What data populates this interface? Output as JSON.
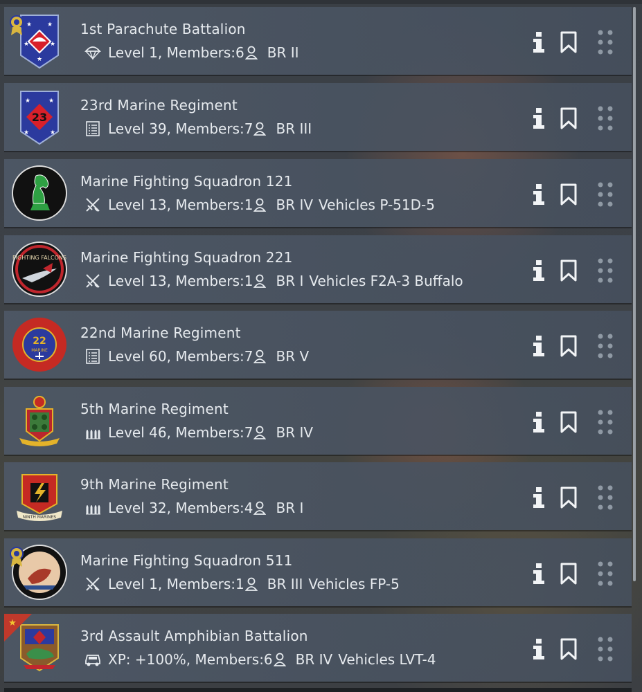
{
  "colors": {
    "text": "#e6eaee",
    "row": "#4e5866",
    "icon": "#f2f4f6",
    "drag": "#8f99a4",
    "accent_gold": "#c9a233",
    "new_badge": "#c0392b"
  },
  "rows": [
    {
      "name": "1st Parachute Battalion",
      "type_icon": "parachute-icon",
      "stat": "Level 1, Members:6",
      "br": "BR II",
      "vehicles": "",
      "badge": "medal"
    },
    {
      "name": "23rd Marine Regiment",
      "type_icon": "list-icon",
      "stat": "Level 39, Members:7",
      "br": "BR III",
      "vehicles": "",
      "badge": ""
    },
    {
      "name": "Marine Fighting Squadron 121",
      "type_icon": "aircraft-icon",
      "stat": "Level 13, Members:1",
      "br": "BR IV",
      "vehicles": "Vehicles P-51D-5",
      "badge": ""
    },
    {
      "name": "Marine Fighting Squadron 221",
      "type_icon": "aircraft-icon",
      "stat": "Level 13, Members:1",
      "br": "BR I",
      "vehicles": "Vehicles F2A-3 Buffalo",
      "badge": ""
    },
    {
      "name": "22nd Marine Regiment",
      "type_icon": "list-icon",
      "stat": "Level 60, Members:7",
      "br": "BR V",
      "vehicles": "",
      "badge": ""
    },
    {
      "name": "5th Marine Regiment",
      "type_icon": "ammo-icon",
      "stat": "Level 46, Members:7",
      "br": "BR IV",
      "vehicles": "",
      "badge": ""
    },
    {
      "name": "9th Marine Regiment",
      "type_icon": "ammo-icon",
      "stat": "Level 32, Members:4",
      "br": "BR I",
      "vehicles": "",
      "badge": ""
    },
    {
      "name": "Marine Fighting Squadron 511",
      "type_icon": "aircraft-icon",
      "stat": "Level 1, Members:1",
      "br": "BR III",
      "vehicles": "Vehicles FP-5",
      "badge": "medal"
    },
    {
      "name": "3rd Assault Amphibian Battalion",
      "type_icon": "vehicle-icon",
      "stat": "XP: +100%, Members:6",
      "br": "BR IV",
      "vehicles": "Vehicles LVT-4",
      "badge": "star-flag"
    }
  ],
  "emblem_text": {
    "r2": "23",
    "r4": "FIGHTING FALCONS",
    "r5_num": "22",
    "r5_mid": "MARINE",
    "r7": "NINTH MARINES"
  }
}
